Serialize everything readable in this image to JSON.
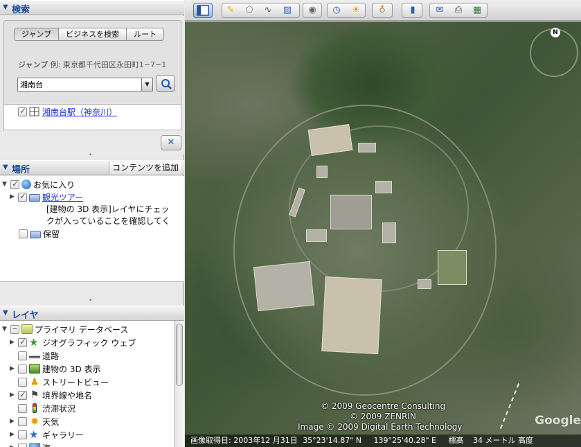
{
  "search": {
    "header": "検索",
    "tabs": [
      "ジャンプ",
      "ビジネスを検索",
      "ルート"
    ],
    "jump_label": "ジャンプ",
    "jump_example": "例: 東京都千代田区永田町1−7−1",
    "input_value": "湘南台",
    "result": "湘南台駅（神奈川）"
  },
  "places": {
    "header": "場所",
    "add_content": "コンテンツを追加",
    "items": [
      {
        "label": "お気に入り"
      },
      {
        "label": "観光ツアー"
      },
      {
        "label": "[建物の 3D 表示]レイヤにチェッ"
      },
      {
        "label": "クが入っていることを確認してく"
      },
      {
        "label": "保留"
      }
    ]
  },
  "layers": {
    "header": "レイヤ",
    "items": [
      {
        "label": "プライマリ データベース"
      },
      {
        "label": "ジオグラフィック ウェブ"
      },
      {
        "label": "道路"
      },
      {
        "label": "建物の 3D 表示"
      },
      {
        "label": "ストリートビュー"
      },
      {
        "label": "境界線や地名"
      },
      {
        "label": "渋滞状況"
      },
      {
        "label": "天気"
      },
      {
        "label": "ギャラリー"
      },
      {
        "label": "海"
      }
    ]
  },
  "toolbar": {
    "buttons": [
      "sidebar",
      "placemark",
      "polygon",
      "path",
      "image-overlay",
      "record-tour",
      "historical-imagery",
      "sunlight",
      "planets",
      "ruler",
      "email",
      "print",
      "view-in-maps"
    ]
  },
  "map": {
    "compass_n": "N",
    "credits": [
      "© 2009 Geocentre Consulting",
      "© 2009 ZENRIN",
      "Image © 2009 Digital Earth Technology"
    ],
    "watermark": "Google",
    "status": {
      "imagery_date": "画像取得日: 2003年12 月31日",
      "lat": "35°23'14.87\" N",
      "lon": "139°25'40.28\" E",
      "elev_label": "標高",
      "elev_value": "34 メートル 高度"
    }
  }
}
